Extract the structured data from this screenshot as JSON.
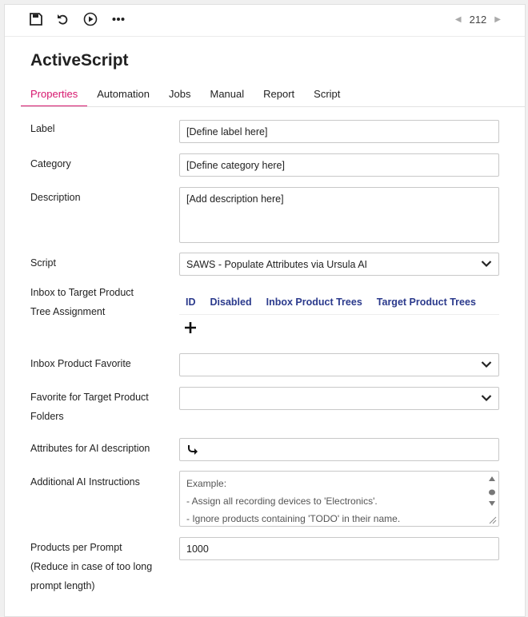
{
  "pager": {
    "number": "212"
  },
  "title": "ActiveScript",
  "tabs": [
    "Properties",
    "Automation",
    "Jobs",
    "Manual",
    "Report",
    "Script"
  ],
  "form": {
    "label": {
      "label": "Label",
      "value": "[Define label here]"
    },
    "category": {
      "label": "Category",
      "value": "[Define category here]"
    },
    "description": {
      "label": "Description",
      "value": "[Add description here]"
    },
    "script": {
      "label": "Script",
      "value": "SAWS - Populate Attributes via Ursula AI"
    },
    "tree_assignment": {
      "label_line1": "Inbox to Target Product",
      "label_line2": "Tree Assignment",
      "columns": [
        "ID",
        "Disabled",
        "Inbox Product Trees",
        "Target Product Trees"
      ]
    },
    "inbox_favorite": {
      "label": "Inbox Product Favorite"
    },
    "target_favorite": {
      "label_line1": "Favorite for Target Product",
      "label_line2": "Folders"
    },
    "ai_attributes": {
      "label": "Attributes for AI description"
    },
    "ai_instructions": {
      "label": "Additional AI Instructions",
      "lines": [
        "Example:",
        "- Assign all recording devices to 'Electronics'.",
        "- Ignore products containing 'TODO' in their name."
      ]
    },
    "products_per_prompt": {
      "label_line1": "Products per Prompt",
      "label_line2": "(Reduce in case of too long",
      "label_line3": "prompt length)",
      "value": "1000"
    }
  },
  "colors": {
    "accent": "#d6166d",
    "header_text": "#2b3a8c"
  }
}
